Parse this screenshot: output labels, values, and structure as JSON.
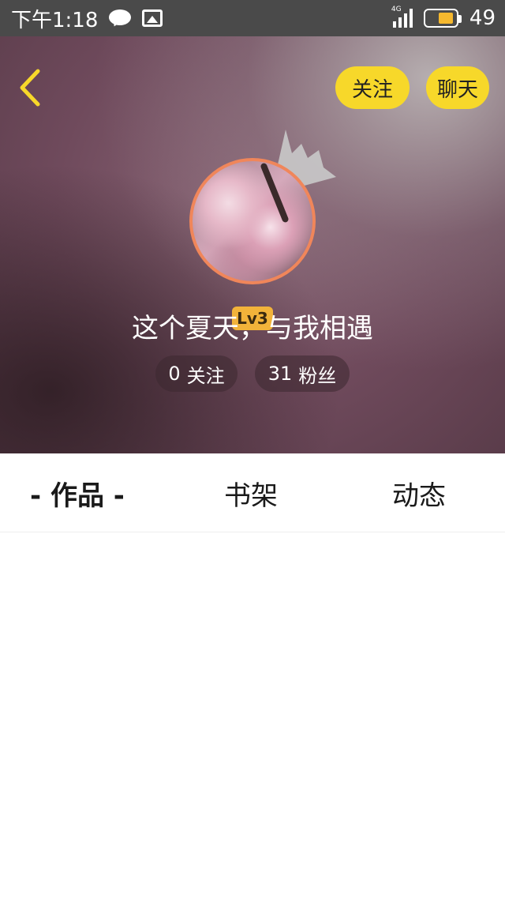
{
  "status_bar": {
    "time": "下午1:18",
    "network": "4G",
    "battery_level": "49",
    "icons": [
      "chat-bubble-icon",
      "gallery-icon",
      "signal-icon",
      "battery-icon"
    ]
  },
  "header": {
    "back_icon": "chevron-left-icon",
    "follow_label": "关注",
    "chat_label": "聊天",
    "accent_color": "#f7d82a"
  },
  "profile": {
    "level": "Lv3",
    "username": "这个夏天，与我相遇",
    "stats": {
      "following_count": "0",
      "following_label": "关注",
      "fans_count": "31",
      "fans_label": "粉丝"
    }
  },
  "tabs": [
    {
      "label": "- 作品 -",
      "selected": true
    },
    {
      "label": "书架",
      "selected": false
    },
    {
      "label": "动态",
      "selected": false
    }
  ]
}
